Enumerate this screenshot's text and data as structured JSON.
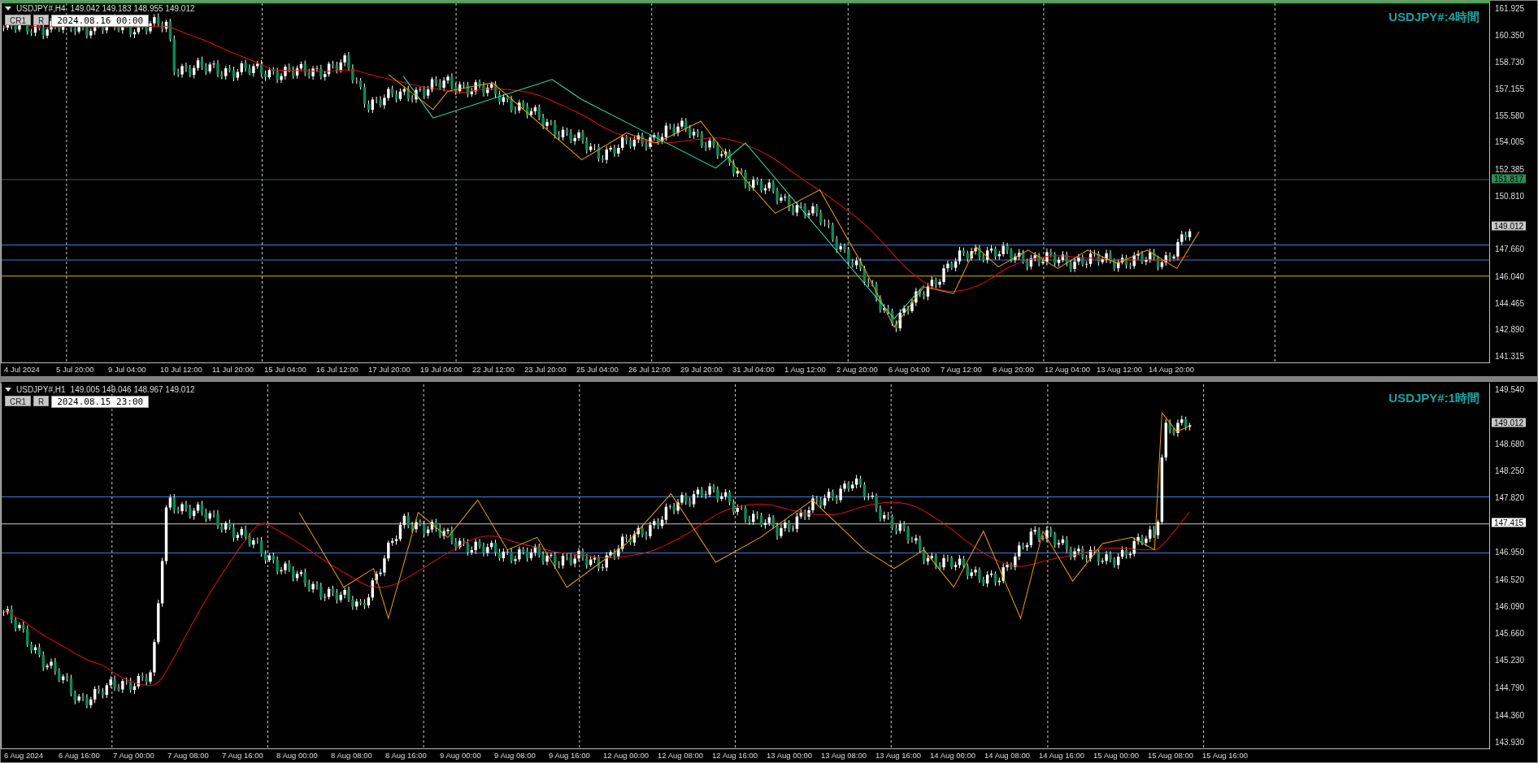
{
  "panels": [
    {
      "active": true,
      "symbol": "USDJPY#,H4",
      "ohlc": "149.042 149.183 148.955 149.012",
      "buttons": [
        "CR1",
        "R"
      ],
      "datetime": "2024.08.16 00:00",
      "title": "USDJPY#:4時間",
      "price_axis": [
        "161.925",
        "160.350",
        "158.730",
        "157.155",
        "155.580",
        "154.005",
        "152.385",
        "150.810",
        "147.660",
        "146.040",
        "144.465",
        "142.890",
        "141.315"
      ],
      "price_markers": [
        {
          "value": "151.817",
          "color": "#2e8b57",
          "kind": "line"
        },
        {
          "value": "149.012",
          "color": "#c8c8c8",
          "kind": "bid"
        }
      ],
      "time_axis": [
        "4 Jul 2024",
        "5 Jul 20:00",
        "9 Jul 04:00",
        "10 Jul 12:00",
        "11 Jul 20:00",
        "15 Jul 04:00",
        "16 Jul 12:00",
        "17 Jul 20:00",
        "19 Jul 04:00",
        "22 Jul 12:00",
        "23 Jul 20:00",
        "25 Jul 04:00",
        "26 Jul 12:00",
        "29 Jul 20:00",
        "31 Jul 04:00",
        "1 Aug 12:00",
        "2 Aug 20:00",
        "6 Aug 04:00",
        "7 Aug 12:00",
        "8 Aug 20:00",
        "12 Aug 04:00",
        "13 Aug 12:00",
        "14 Aug 20:00"
      ]
    },
    {
      "active": false,
      "symbol": "USDJPY#,H1",
      "ohlc": "149.005 149.046 148.967 149.012",
      "buttons": [
        "CR1",
        "R"
      ],
      "datetime": "2024.08.15 23:00",
      "title": "USDJPY#:1時間",
      "price_axis": [
        "149.540",
        "148.680",
        "148.250",
        "147.820",
        "146.950",
        "146.520",
        "146.090",
        "145.660",
        "145.230",
        "144.790",
        "144.360",
        "143.930"
      ],
      "price_markers": [
        {
          "value": "149.012",
          "color": "#c8c8c8",
          "kind": "bid"
        },
        {
          "value": "147.415",
          "color": "#ffffff",
          "kind": "line"
        }
      ],
      "time_axis": [
        "6 Aug 2024",
        "6 Aug 16:00",
        "7 Aug 00:00",
        "7 Aug 08:00",
        "7 Aug 16:00",
        "8 Aug 00:00",
        "8 Aug 08:00",
        "8 Aug 16:00",
        "9 Aug 00:00",
        "9 Aug 08:00",
        "9 Aug 16:00",
        "12 Aug 00:00",
        "12 Aug 08:00",
        "12 Aug 16:00",
        "13 Aug 00:00",
        "13 Aug 08:00",
        "13 Aug 16:00",
        "14 Aug 00:00",
        "14 Aug 08:00",
        "14 Aug 16:00",
        "15 Aug 00:00",
        "15 Aug 08:00",
        "15 Aug 16:00"
      ]
    }
  ]
}
